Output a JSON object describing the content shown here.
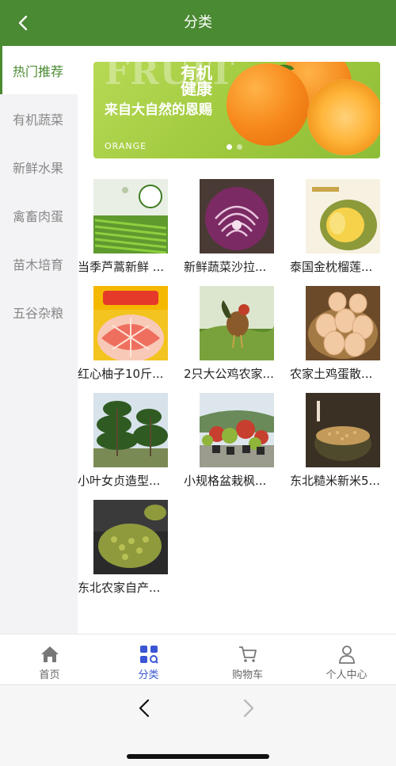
{
  "header": {
    "title": "分类"
  },
  "sidebar": {
    "items": [
      {
        "label": "热门推荐",
        "active": true
      },
      {
        "label": "有机蔬菜",
        "active": false
      },
      {
        "label": "新鲜水果",
        "active": false
      },
      {
        "label": "禽畜肉蛋",
        "active": false
      },
      {
        "label": "苗木培育",
        "active": false
      },
      {
        "label": "五谷杂粮",
        "active": false
      }
    ]
  },
  "banner": {
    "text_fruit": "FRUIT",
    "line1": "有机",
    "line2": "健康",
    "slogan": "来自大自然的恩赐",
    "subtext": "ORANGE",
    "slides": 2,
    "active_slide": 0
  },
  "products": [
    {
      "name": "当季芦蒿新鲜 ...",
      "image": "asparagus-greens"
    },
    {
      "name": "新鲜蔬菜沙拉...",
      "image": "purple-cabbage"
    },
    {
      "name": "泰国金枕榴莲...",
      "image": "durian"
    },
    {
      "name": "红心柚子10斤...",
      "image": "red-pomelo"
    },
    {
      "name": "2只大公鸡农家...",
      "image": "rooster"
    },
    {
      "name": "农家土鸡蛋散...",
      "image": "eggs"
    },
    {
      "name": "小叶女贞造型...",
      "image": "privet-trees"
    },
    {
      "name": "小规格盆栽枫...",
      "image": "potted-maples"
    },
    {
      "name": "东北糙米新米5...",
      "image": "brown-rice"
    },
    {
      "name": "东北农家自产...",
      "image": "mung-beans"
    }
  ],
  "bottom_nav": {
    "items": [
      {
        "label": "首页",
        "icon": "home-icon",
        "active": false
      },
      {
        "label": "分类",
        "icon": "category-icon",
        "active": true
      },
      {
        "label": "购物车",
        "icon": "cart-icon",
        "active": false
      },
      {
        "label": "个人中心",
        "icon": "person-icon",
        "active": false
      }
    ]
  },
  "colors": {
    "primary": "#4a8a32",
    "nav_active": "#3a56d4",
    "sidebar_bg": "#f3f3f5"
  }
}
